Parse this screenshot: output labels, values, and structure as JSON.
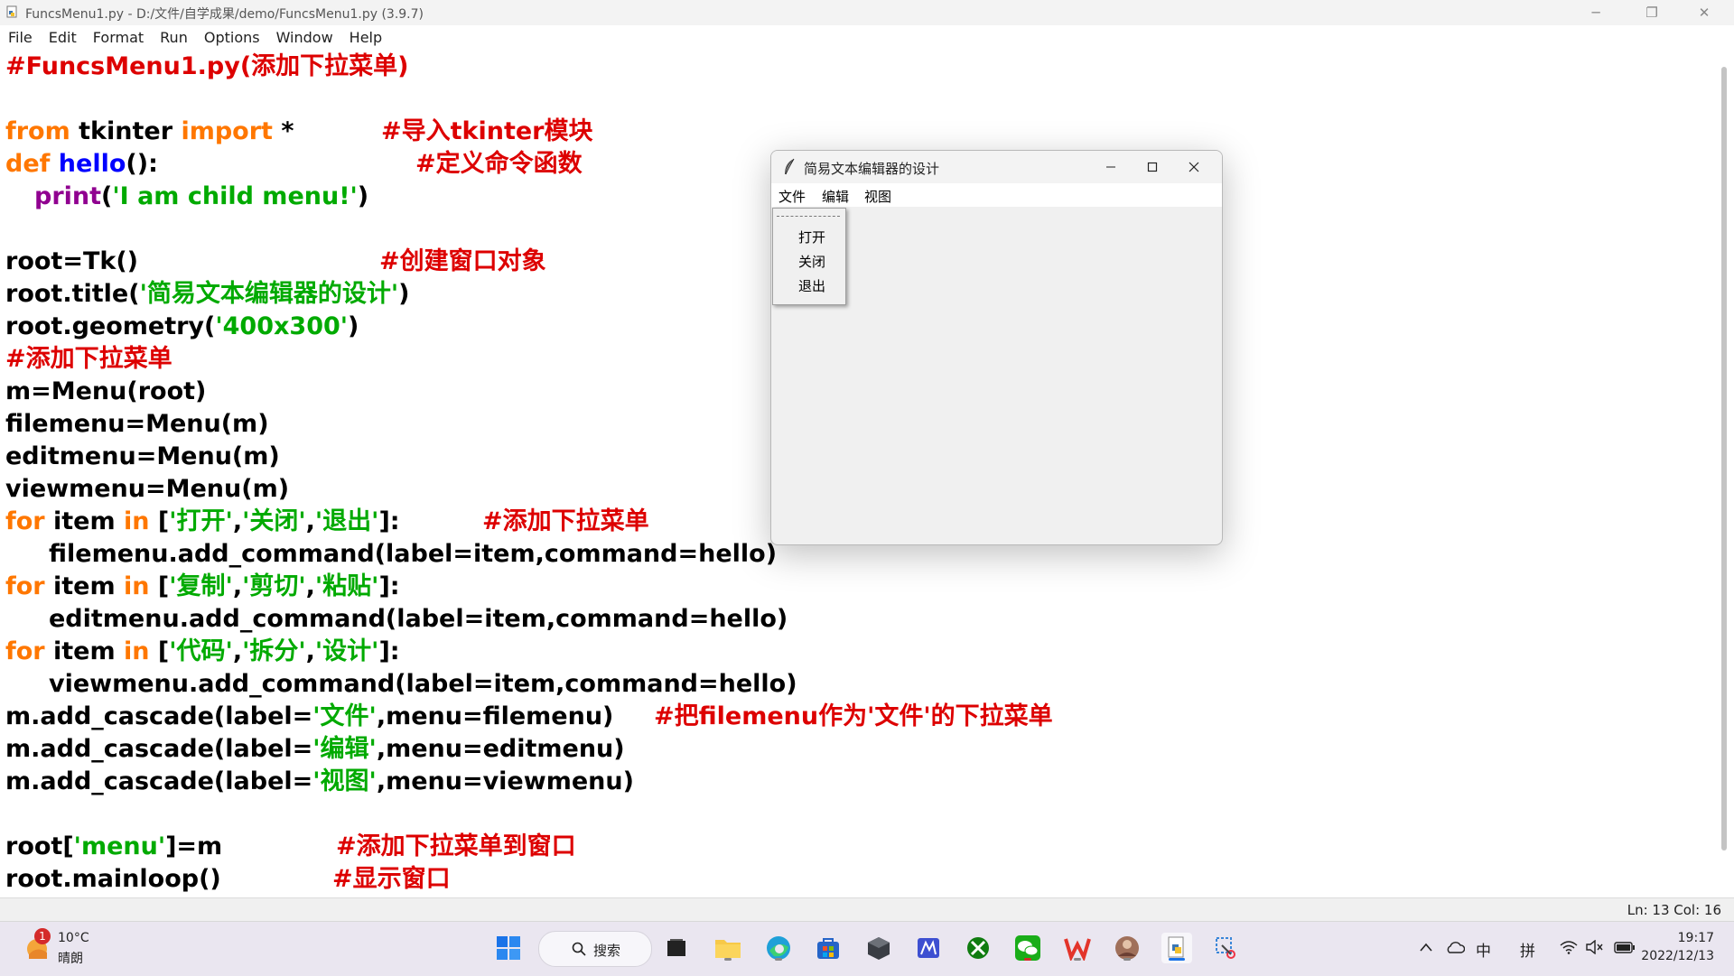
{
  "window": {
    "title": "FuncsMenu1.py - D:/文件/自学成果/demo/FuncsMenu1.py (3.9.7)",
    "minimize_glyph": "─",
    "restore_glyph": "❐",
    "close_glyph": "✕"
  },
  "menubar": [
    "File",
    "Edit",
    "Format",
    "Run",
    "Options",
    "Window",
    "Help"
  ],
  "code": {
    "l1": "#FuncsMenu1.py(添加下拉菜单)",
    "l3_kw1": "from",
    "l3_mid": " tkinter ",
    "l3_kw2": "import",
    "l3_end": " *",
    "l3_cm": "#导入tkinter模块",
    "l4_kw": "def",
    "l4_fn": " hello",
    "l4_end": "():",
    "l4_cm": "#定义命令函数",
    "l5_bi": "print",
    "l5_p1": "(",
    "l5_str": "'I am child menu!'",
    "l5_p2": ")",
    "l7": "root=Tk()",
    "l7_cm": "#创建窗口对象",
    "l8_a": "root.title(",
    "l8_str": "'简易文本编辑器的设计'",
    "l8_b": ")",
    "l9_a": "root.geometry(",
    "l9_str": "'400x300'",
    "l9_b": ")",
    "l10": "#添加下拉菜单",
    "l11": "m=Menu(root)",
    "l12": "filemenu=Menu(m)",
    "l13": "editmenu=Menu(m)",
    "l14": "viewmenu=Menu(m)",
    "l15_kw1": "for",
    "l15_a": " item ",
    "l15_kw2": "in",
    "l15_b": " [",
    "l15_s1": "'打开'",
    "l15_c1": ",",
    "l15_s2": "'关闭'",
    "l15_c2": ",",
    "l15_s3": "'退出'",
    "l15_e": "]:",
    "l15_cm": "#添加下拉菜单",
    "l16": "filemenu.add_command(label=item,command=hello)",
    "l17_kw1": "for",
    "l17_a": " item ",
    "l17_kw2": "in",
    "l17_b": " [",
    "l17_s1": "'复制'",
    "l17_c1": ",",
    "l17_s2": "'剪切'",
    "l17_c2": ",",
    "l17_s3": "'粘贴'",
    "l17_e": "]:",
    "l18": "editmenu.add_command(label=item,command=hello)",
    "l19_kw1": "for",
    "l19_a": " item ",
    "l19_kw2": "in",
    "l19_b": " [",
    "l19_s1": "'代码'",
    "l19_c1": ",",
    "l19_s2": "'拆分'",
    "l19_c2": ",",
    "l19_s3": "'设计'",
    "l19_e": "]:",
    "l20": "viewmenu.add_command(label=item,command=hello)",
    "l21_a": "m.add_cascade(label=",
    "l21_str": "'文件'",
    "l21_b": ",menu=filemenu)",
    "l21_cm": "#把filemenu作为'文件'的下拉菜单",
    "l22_a": "m.add_cascade(label=",
    "l22_str": "'编辑'",
    "l22_b": ",menu=editmenu)",
    "l23_a": "m.add_cascade(label=",
    "l23_str": "'视图'",
    "l23_b": ",menu=viewmenu)",
    "l25_a": "root[",
    "l25_str": "'menu'",
    "l25_b": "]=m",
    "l25_cm": "#添加下拉菜单到窗口",
    "l26": "root.mainloop()",
    "l26_cm": "#显示窗口"
  },
  "status": {
    "position": "Ln: 13   Col: 16"
  },
  "tk_window": {
    "title": "简易文本编辑器的设计",
    "menus": [
      "文件",
      "编辑",
      "视图"
    ],
    "dropdown_items": [
      "打开",
      "关闭",
      "退出"
    ]
  },
  "taskbar": {
    "weather_badge": "1",
    "temperature": "10°C",
    "weather": "晴朗",
    "search_label": "搜索",
    "ime_lang": "中",
    "ime_mode": "拼",
    "time": "19:17",
    "date": "2022/12/13"
  },
  "colors": {
    "keyword": "#ff7700",
    "builtin": "#900090",
    "string": "#00aa00",
    "comment": "#dd0000",
    "definition": "#0000ff"
  }
}
